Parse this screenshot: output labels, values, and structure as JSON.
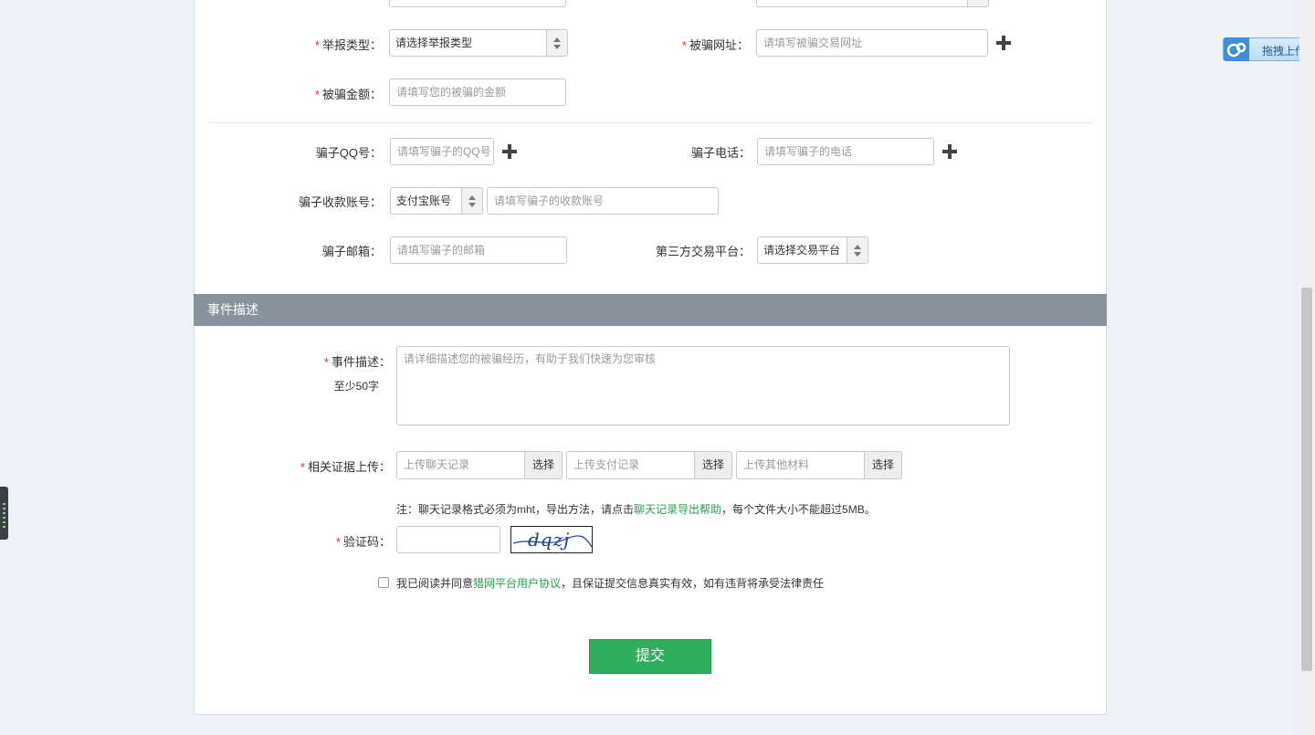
{
  "form": {
    "report_type": {
      "label": "举报类型：",
      "value": "请选择举报类型"
    },
    "fraud_url": {
      "label": "被骗网址：",
      "placeholder": "请填写被骗交易网址"
    },
    "fraud_amount": {
      "label": "被骗金额：",
      "placeholder": "请填写您的被骗的金额"
    },
    "scammer_qq": {
      "label": "骗子QQ号：",
      "placeholder": "请填写骗子的QQ号"
    },
    "scammer_phone": {
      "label": "骗子电话：",
      "placeholder": "请填写骗子的电话"
    },
    "scammer_account": {
      "label": "骗子收款账号：",
      "type_value": "支付宝账号",
      "placeholder": "请填写骗子的收款账号"
    },
    "scammer_email": {
      "label": "骗子邮箱：",
      "placeholder": "请填写骗子的邮箱"
    },
    "third_party_platform": {
      "label": "第三方交易平台：",
      "value": "请选择交易平台"
    }
  },
  "event": {
    "section_title": "事件描述",
    "description": {
      "label": "事件描述：",
      "hint": "至少50字",
      "placeholder": "请详细描述您的被骗经历，有助于我们快速为您审核"
    },
    "evidence": {
      "label": "相关证据上传：",
      "chat_placeholder": "上传聊天记录",
      "payment_placeholder": "上传支付记录",
      "other_placeholder": "上传其他材料",
      "choose_label": "选择"
    },
    "note": {
      "prefix": "注：聊天记录格式必须为mht，导出方法，请点击",
      "link": "聊天记录导出帮助",
      "suffix": "，每个文件大小不能超过5MB。"
    },
    "captcha": {
      "label": "验证码：",
      "image_text": "dqzj"
    },
    "agreement": {
      "prefix": "我已阅读并同意",
      "link": "猎网平台用户协议",
      "suffix": "，且保证提交信息真实有效，如有违背将承受法律责任"
    },
    "submit_label": "提交"
  },
  "widget": {
    "upload_label": "拖拽上传"
  },
  "colors": {
    "accent_green": "#2eae5c",
    "link_green": "#28a04e",
    "required_red": "#e0332e",
    "section_bar": "#88939e"
  }
}
